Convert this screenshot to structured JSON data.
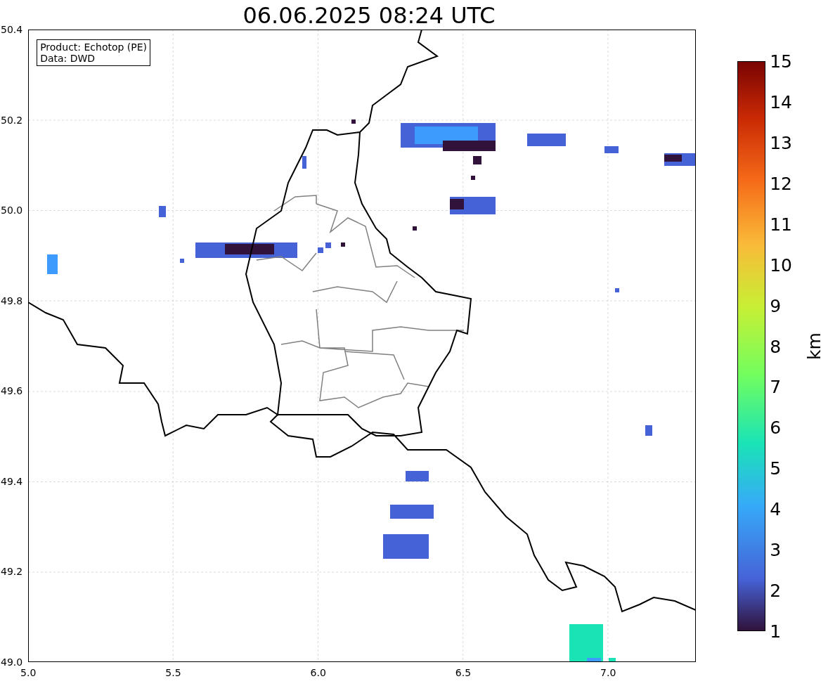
{
  "title": "06.06.2025 08:24 UTC",
  "legend": [
    "Product: Echotop (PE)",
    "Data: DWD"
  ],
  "x_ticks": [
    "5.0",
    "5.5",
    "6.0",
    "6.5",
    "7.0"
  ],
  "y_ticks": [
    "50.4",
    "50.2",
    "50.0",
    "49.8",
    "49.6",
    "49.4",
    "49.2",
    "49.0"
  ],
  "colorbar": {
    "label": "km",
    "ticks": [
      "15",
      "14",
      "13",
      "12",
      "11",
      "10",
      "9",
      "8",
      "7",
      "6",
      "5",
      "4",
      "3",
      "2",
      "1"
    ]
  }
}
